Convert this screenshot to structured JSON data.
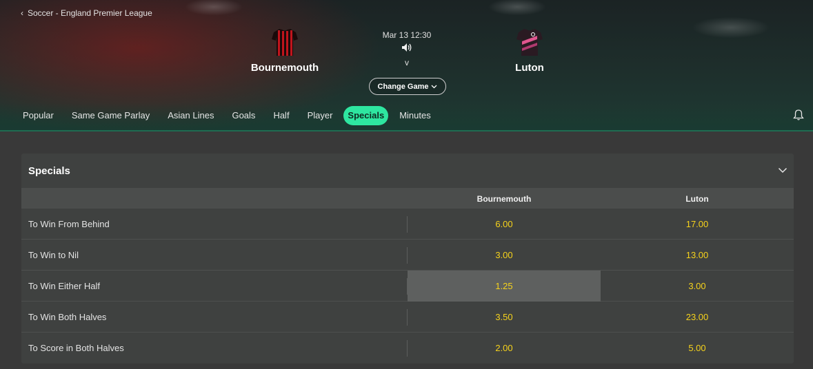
{
  "breadcrumb": {
    "label": "Soccer - England Premier League"
  },
  "match": {
    "home_team": "Bournemouth",
    "away_team": "Luton",
    "time": "Mar 13 12:30",
    "separator": "v",
    "change_game_label": "Change Game"
  },
  "tabs": [
    {
      "label": "Popular"
    },
    {
      "label": "Same Game Parlay"
    },
    {
      "label": "Asian Lines"
    },
    {
      "label": "Goals"
    },
    {
      "label": "Half"
    },
    {
      "label": "Player"
    },
    {
      "label": "Specials",
      "active": true
    },
    {
      "label": "Minutes"
    }
  ],
  "specials": {
    "title": "Specials",
    "columns": [
      "Bournemouth",
      "Luton"
    ],
    "rows": [
      {
        "label": "To Win From Behind",
        "odds": [
          "6.00",
          "17.00"
        ]
      },
      {
        "label": "To Win to Nil",
        "odds": [
          "3.00",
          "13.00"
        ]
      },
      {
        "label": "To Win Either Half",
        "odds": [
          "1.25",
          "3.00"
        ]
      },
      {
        "label": "To Win Both Halves",
        "odds": [
          "3.50",
          "23.00"
        ]
      },
      {
        "label": "To Score in Both Halves",
        "odds": [
          "2.00",
          "5.00"
        ]
      }
    ]
  },
  "colors": {
    "accent": "#2ee6a0",
    "odds": "#f7d31b",
    "home_jersey": "#c0141c",
    "away_jersey": "#e0568f"
  },
  "icons": [
    "chevron-left-icon",
    "home-jersey-icon",
    "away-jersey-icon",
    "speaker-icon",
    "chevron-down-icon",
    "bell-icon"
  ]
}
